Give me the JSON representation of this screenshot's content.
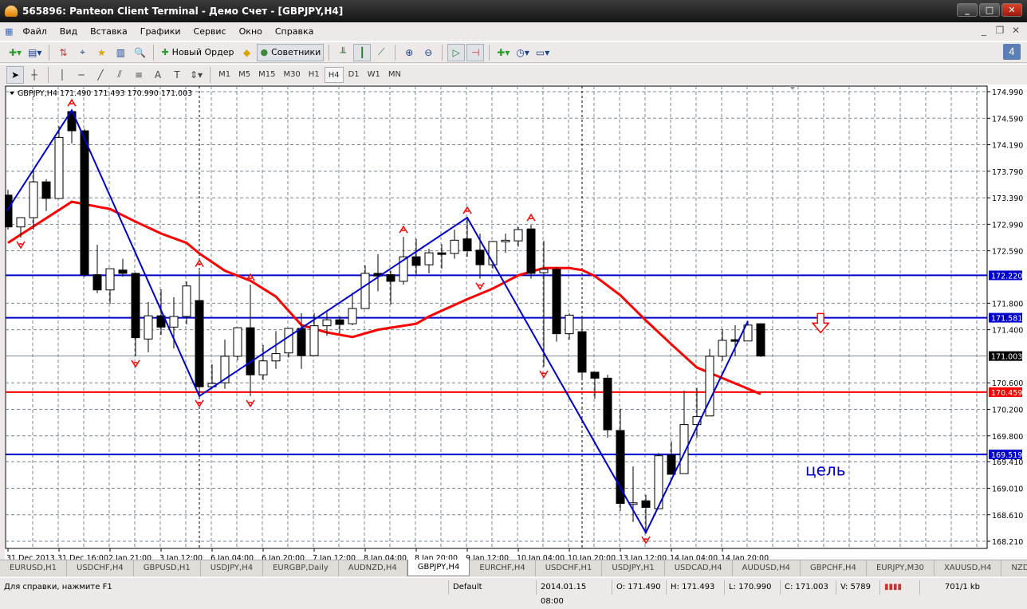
{
  "window": {
    "title": "565896: Panteon Client Terminal - Демо Счет - [GBPJPY,H4]"
  },
  "menu": [
    "Файл",
    "Вид",
    "Вставка",
    "Графики",
    "Сервис",
    "Окно",
    "Справка"
  ],
  "toolbar": {
    "new_order_label": "Новый Ордер",
    "experts_label": "Советники",
    "notifications_count": "4"
  },
  "timeframes": [
    "M1",
    "M5",
    "M15",
    "M30",
    "H1",
    "H4",
    "D1",
    "W1",
    "MN"
  ],
  "active_timeframe": "H4",
  "chart_header": "GBPJPY,H4  171.490 171.493 170.990 171.003",
  "annotation_text": "цель",
  "tabs": [
    "EURUSD,H1",
    "USDCHF,H4",
    "GBPUSD,H1",
    "USDJPY,H4",
    "EURGBP,Daily",
    "AUDNZD,H4",
    "GBPJPY,H4",
    "EURCHF,H4",
    "USDCHF,H1",
    "USDJPY,H1",
    "USDCAD,H4",
    "AUDUSD,H4",
    "GBPCHF,H4",
    "EURJPY,M30",
    "XAUUSD,H4",
    "NZDUS"
  ],
  "active_tab": "GBPJPY,H4",
  "status": {
    "help": "Для справки, нажмите F1",
    "profile": "Default",
    "time": "2014.01.15 08:00",
    "open": "O: 171.490",
    "high": "H: 171.493",
    "low": "L: 170.990",
    "close": "C: 171.003",
    "volume": "V: 5789",
    "traffic": "701/1 kb"
  },
  "colors": {
    "bull": "#ffffff",
    "bear": "#000000",
    "ma": "#ff0000",
    "zigzag": "#0000cc",
    "level_blue": "#0000cc",
    "level_red": "#ff0000",
    "bid": "#808890"
  },
  "chart_data": {
    "type": "candlestick",
    "symbol": "GBPJPY",
    "timeframe": "H4",
    "ylim": [
      168.13,
      175.07
    ],
    "yticks": [
      "174.990",
      "174.590",
      "174.190",
      "173.790",
      "173.390",
      "172.990",
      "172.590",
      "171.800",
      "171.400",
      "170.600",
      "170.200",
      "169.800",
      "169.410",
      "169.010",
      "168.610",
      "168.210"
    ],
    "ytick_values": [
      174.99,
      174.59,
      174.19,
      173.79,
      173.39,
      172.99,
      172.59,
      171.8,
      171.4,
      170.6,
      170.2,
      169.8,
      169.41,
      169.01,
      168.61,
      168.21
    ],
    "grid": true,
    "xticks": [
      "31 Dec 2013",
      "31 Dec 16:00",
      "2 Jan 21:00",
      "3 Jan 12:00",
      "6 Jan 04:00",
      "6 Jan 20:00",
      "7 Jan 12:00",
      "8 Jan 04:00",
      "8 Jan 20:00",
      "9 Jan 12:00",
      "10 Jan 04:00",
      "10 Jan 20:00",
      "13 Jan 12:00",
      "14 Jan 04:00",
      "14 Jan 20:00"
    ],
    "candles": [
      [
        173.43,
        173.51,
        172.91,
        172.95
      ],
      [
        172.95,
        173.09,
        172.79,
        173.09
      ],
      [
        173.09,
        173.82,
        172.91,
        173.63
      ],
      [
        173.63,
        173.67,
        173.19,
        173.38
      ],
      [
        173.38,
        174.47,
        173.38,
        174.3
      ],
      [
        174.69,
        174.71,
        174.21,
        174.4
      ],
      [
        174.4,
        174.43,
        172.2,
        172.23
      ],
      [
        172.23,
        172.68,
        171.95,
        172.0
      ],
      [
        172.0,
        172.32,
        171.79,
        172.32
      ],
      [
        172.3,
        172.47,
        172.2,
        172.25
      ],
      [
        172.25,
        172.26,
        171.0,
        171.28
      ],
      [
        171.26,
        171.82,
        171.06,
        171.61
      ],
      [
        171.61,
        172.01,
        171.32,
        171.44
      ],
      [
        171.44,
        171.89,
        171.12,
        171.6
      ],
      [
        171.6,
        172.13,
        171.48,
        172.06
      ],
      [
        171.84,
        172.29,
        170.4,
        170.54
      ],
      [
        170.54,
        170.88,
        170.51,
        170.59
      ],
      [
        170.6,
        171.25,
        170.51,
        171.0
      ],
      [
        171.0,
        171.43,
        170.94,
        171.43
      ],
      [
        171.43,
        172.08,
        170.4,
        170.72
      ],
      [
        170.72,
        171.17,
        170.64,
        170.93
      ],
      [
        170.93,
        171.38,
        170.81,
        171.04
      ],
      [
        171.05,
        171.42,
        170.98,
        171.42
      ],
      [
        171.42,
        171.65,
        170.81,
        171.01
      ],
      [
        171.01,
        171.65,
        171.01,
        171.46
      ],
      [
        171.46,
        171.66,
        171.31,
        171.55
      ],
      [
        171.55,
        171.6,
        171.35,
        171.48
      ],
      [
        171.49,
        171.96,
        171.47,
        171.72
      ],
      [
        171.72,
        172.37,
        171.72,
        172.25
      ],
      [
        172.25,
        172.54,
        171.98,
        172.21
      ],
      [
        172.23,
        172.29,
        171.78,
        172.13
      ],
      [
        172.13,
        172.8,
        172.08,
        172.5
      ],
      [
        172.5,
        172.77,
        172.23,
        172.37
      ],
      [
        172.38,
        172.62,
        172.25,
        172.56
      ],
      [
        172.56,
        172.69,
        172.32,
        172.54
      ],
      [
        172.55,
        172.91,
        172.47,
        172.75
      ],
      [
        172.77,
        173.09,
        172.5,
        172.59
      ],
      [
        172.6,
        172.85,
        172.17,
        172.38
      ],
      [
        172.38,
        172.74,
        172.32,
        172.73
      ],
      [
        172.73,
        172.85,
        172.56,
        172.75
      ],
      [
        172.74,
        172.95,
        172.65,
        172.91
      ],
      [
        172.92,
        172.98,
        172.17,
        172.25
      ],
      [
        172.26,
        172.74,
        170.84,
        172.31
      ],
      [
        172.31,
        172.35,
        171.22,
        171.34
      ],
      [
        171.34,
        171.65,
        171.25,
        171.62
      ],
      [
        171.37,
        171.6,
        170.64,
        170.76
      ],
      [
        170.76,
        170.76,
        170.36,
        170.67
      ],
      [
        170.67,
        170.72,
        169.77,
        169.89
      ],
      [
        169.88,
        170.21,
        168.67,
        168.78
      ],
      [
        168.78,
        169.34,
        168.5,
        168.79
      ],
      [
        168.82,
        168.91,
        168.34,
        168.72
      ],
      [
        168.7,
        169.54,
        168.7,
        169.5
      ],
      [
        169.51,
        169.72,
        169.22,
        169.22
      ],
      [
        169.23,
        170.48,
        169.23,
        169.97
      ],
      [
        169.97,
        170.52,
        169.77,
        170.09
      ],
      [
        170.1,
        171.11,
        170.1,
        171.0
      ],
      [
        171.0,
        171.41,
        170.93,
        171.24
      ],
      [
        171.25,
        171.47,
        171.0,
        171.23
      ],
      [
        171.23,
        171.53,
        171.23,
        171.47
      ],
      [
        171.49,
        171.493,
        170.99,
        171.003
      ]
    ],
    "moving_average": [
      [
        0,
        172.71
      ],
      [
        5,
        173.33
      ],
      [
        8,
        173.22
      ],
      [
        10,
        173.03
      ],
      [
        12,
        172.85
      ],
      [
        14,
        172.71
      ],
      [
        15,
        172.55
      ],
      [
        17,
        172.29
      ],
      [
        19,
        172.14
      ],
      [
        21,
        171.9
      ],
      [
        23,
        171.47
      ],
      [
        25,
        171.36
      ],
      [
        27,
        171.29
      ],
      [
        29,
        171.4
      ],
      [
        32,
        171.49
      ],
      [
        33,
        171.6
      ],
      [
        36,
        171.86
      ],
      [
        38,
        172.02
      ],
      [
        40,
        172.22
      ],
      [
        42,
        172.33
      ],
      [
        44,
        172.33
      ],
      [
        45,
        172.3
      ],
      [
        46,
        172.21
      ],
      [
        48,
        171.92
      ],
      [
        50,
        171.54
      ],
      [
        52,
        171.18
      ],
      [
        54,
        170.83
      ],
      [
        55,
        170.75
      ],
      [
        57,
        170.59
      ],
      [
        59,
        170.43
      ]
    ],
    "zigzag": [
      [
        -0.1,
        173.19
      ],
      [
        5,
        174.71
      ],
      [
        15,
        170.4
      ],
      [
        36,
        173.09
      ],
      [
        50,
        168.34
      ],
      [
        58,
        171.53
      ]
    ],
    "fractals_up": [
      5,
      15,
      19,
      31,
      36,
      41
    ],
    "fractals_down": [
      1,
      10,
      15,
      19,
      37,
      42,
      50
    ],
    "period_separators": [
      15,
      45
    ],
    "levels": [
      {
        "price": 172.22,
        "label": "172.220",
        "color": "#0000cc"
      },
      {
        "price": 171.581,
        "label": "171.581",
        "color": "#0000cc"
      },
      {
        "price": 171.003,
        "label": "171.003",
        "color": "#000000",
        "line": "#808890"
      },
      {
        "price": 170.459,
        "label": "170.459",
        "color": "#ff0000"
      },
      {
        "price": 169.519,
        "label": "169.519",
        "color": "#0000cc"
      }
    ],
    "arrow_annotation": {
      "direction": "down",
      "candle": 63.7,
      "price": 171.5
    },
    "text_annotation": {
      "candle": 62.5,
      "price": 169.2
    }
  }
}
